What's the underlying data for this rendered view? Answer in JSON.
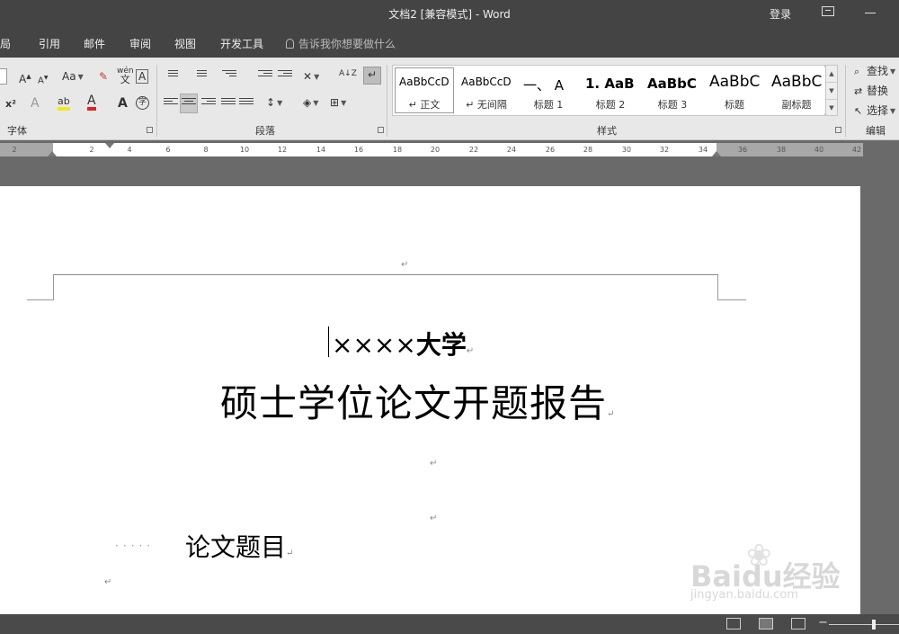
{
  "window": {
    "title": "文档2 [兼容模式]  -  Word",
    "login": "登录"
  },
  "tabs": [
    {
      "label": "布局"
    },
    {
      "label": "引用"
    },
    {
      "label": "邮件"
    },
    {
      "label": "审阅"
    },
    {
      "label": "视图"
    },
    {
      "label": "开发工具"
    }
  ],
  "tell_me": "告诉我你想要做什么",
  "ribbon": {
    "font": {
      "label": "字体",
      "grow": "A",
      "shrink": "A",
      "change_case": "Aa",
      "phonetic": "wén",
      "phonetic_sub": "文",
      "char_border": "A",
      "superscript": "x²",
      "text_effects": "A",
      "highlight": "ab",
      "font_color": "A",
      "char_shading": "A",
      "enclose": "字"
    },
    "paragraph": {
      "label": "段落",
      "sort": "A↓Z"
    },
    "styles": {
      "label": "样式",
      "items": [
        {
          "sample": "AaBbCcD",
          "name": "↵ 正文"
        },
        {
          "sample": "AaBbCcD",
          "name": "↵ 无间隔"
        },
        {
          "sample": "一、 A",
          "name": "标题 1"
        },
        {
          "sample": "1. AaB",
          "name": "标题 2"
        },
        {
          "sample": "AaBbC",
          "name": "标题 3"
        },
        {
          "sample": "AaBbC",
          "name": "标题"
        },
        {
          "sample": "AaBbC",
          "name": "副标题"
        }
      ]
    },
    "editing": {
      "label": "编辑",
      "find": "查找",
      "replace": "替换",
      "select": "选择"
    }
  },
  "ruler": {
    "ticks": [
      "2",
      "2",
      "4",
      "6",
      "8",
      "10",
      "12",
      "14",
      "16",
      "18",
      "20",
      "22",
      "24",
      "26",
      "28",
      "30",
      "32",
      "34",
      "36",
      "38",
      "40",
      "42"
    ]
  },
  "document": {
    "para_mark": "↵",
    "university_prefix": "××××",
    "university_suffix": "大学",
    "report_title": "硕士学位论文开题报告",
    "dots": "·····",
    "thesis_label": "论文题目"
  },
  "watermark": {
    "brand": "Baidu经验",
    "url": "jingyan.baidu.com"
  }
}
